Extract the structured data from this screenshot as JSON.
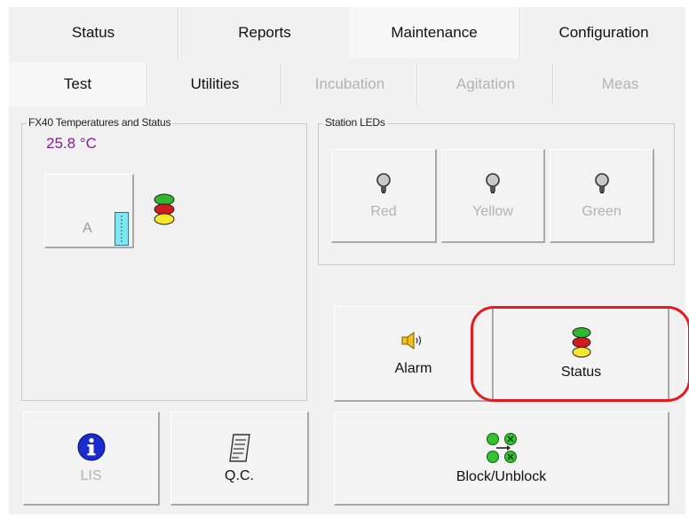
{
  "main_tabs": [
    {
      "label": "Status"
    },
    {
      "label": "Reports"
    },
    {
      "label": "Maintenance"
    },
    {
      "label": "Configuration"
    }
  ],
  "sub_tabs": [
    {
      "label": "Test",
      "enabled": true
    },
    {
      "label": "Utilities",
      "enabled": true
    },
    {
      "label": "Incubation",
      "enabled": false
    },
    {
      "label": "Agitation",
      "enabled": false
    },
    {
      "label": "Meas",
      "enabled": false
    }
  ],
  "temp_panel": {
    "title": "FX40 Temperatures and Status",
    "temperature": "25.8 °C",
    "temperature_color": "#8a1e8c",
    "slot_label": "A"
  },
  "led_panel": {
    "title": "Station LEDs",
    "leds": [
      {
        "label": "Red"
      },
      {
        "label": "Yellow"
      },
      {
        "label": "Green"
      }
    ]
  },
  "buttons": {
    "alarm": "Alarm",
    "status": "Status",
    "lis": "LIS",
    "qc": "Q.C.",
    "block": "Block/Unblock"
  },
  "icons": {
    "alarm": "speaker-icon",
    "status": "traffic-light-icon",
    "lis": "info-icon",
    "qc": "document-icon",
    "block": "block-unblock-icon",
    "led": "light-bulb-icon"
  },
  "colors": {
    "highlight_circle": "#e8191f",
    "info_blue": "#1a2ccf",
    "disabled_text": "#b3b3b3"
  }
}
